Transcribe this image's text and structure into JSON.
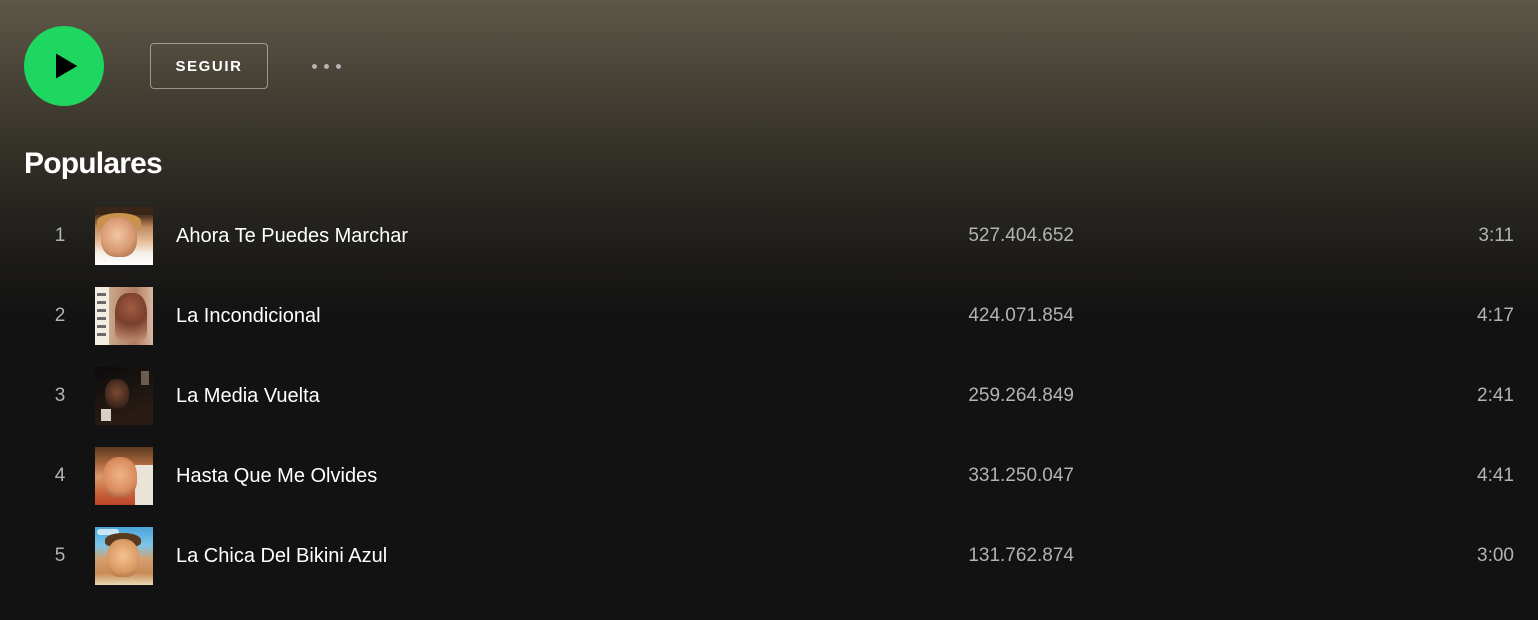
{
  "actions": {
    "play_icon": "play-icon",
    "follow_label": "SEGUIR",
    "more_icon": "more-options-icon",
    "accent_color": "#1ed760"
  },
  "section": {
    "title": "Populares"
  },
  "tracks": [
    {
      "index": "1",
      "title": "Ahora Te Puedes Marchar",
      "plays": "527.404.652",
      "duration": "3:11"
    },
    {
      "index": "2",
      "title": "La Incondicional",
      "plays": "424.071.854",
      "duration": "4:17"
    },
    {
      "index": "3",
      "title": "La Media Vuelta",
      "plays": "259.264.849",
      "duration": "2:41"
    },
    {
      "index": "4",
      "title": "Hasta Que Me Olvides",
      "plays": "331.250.047",
      "duration": "4:41"
    },
    {
      "index": "5",
      "title": "La Chica Del Bikini Azul",
      "plays": "131.762.874",
      "duration": "3:00"
    }
  ]
}
